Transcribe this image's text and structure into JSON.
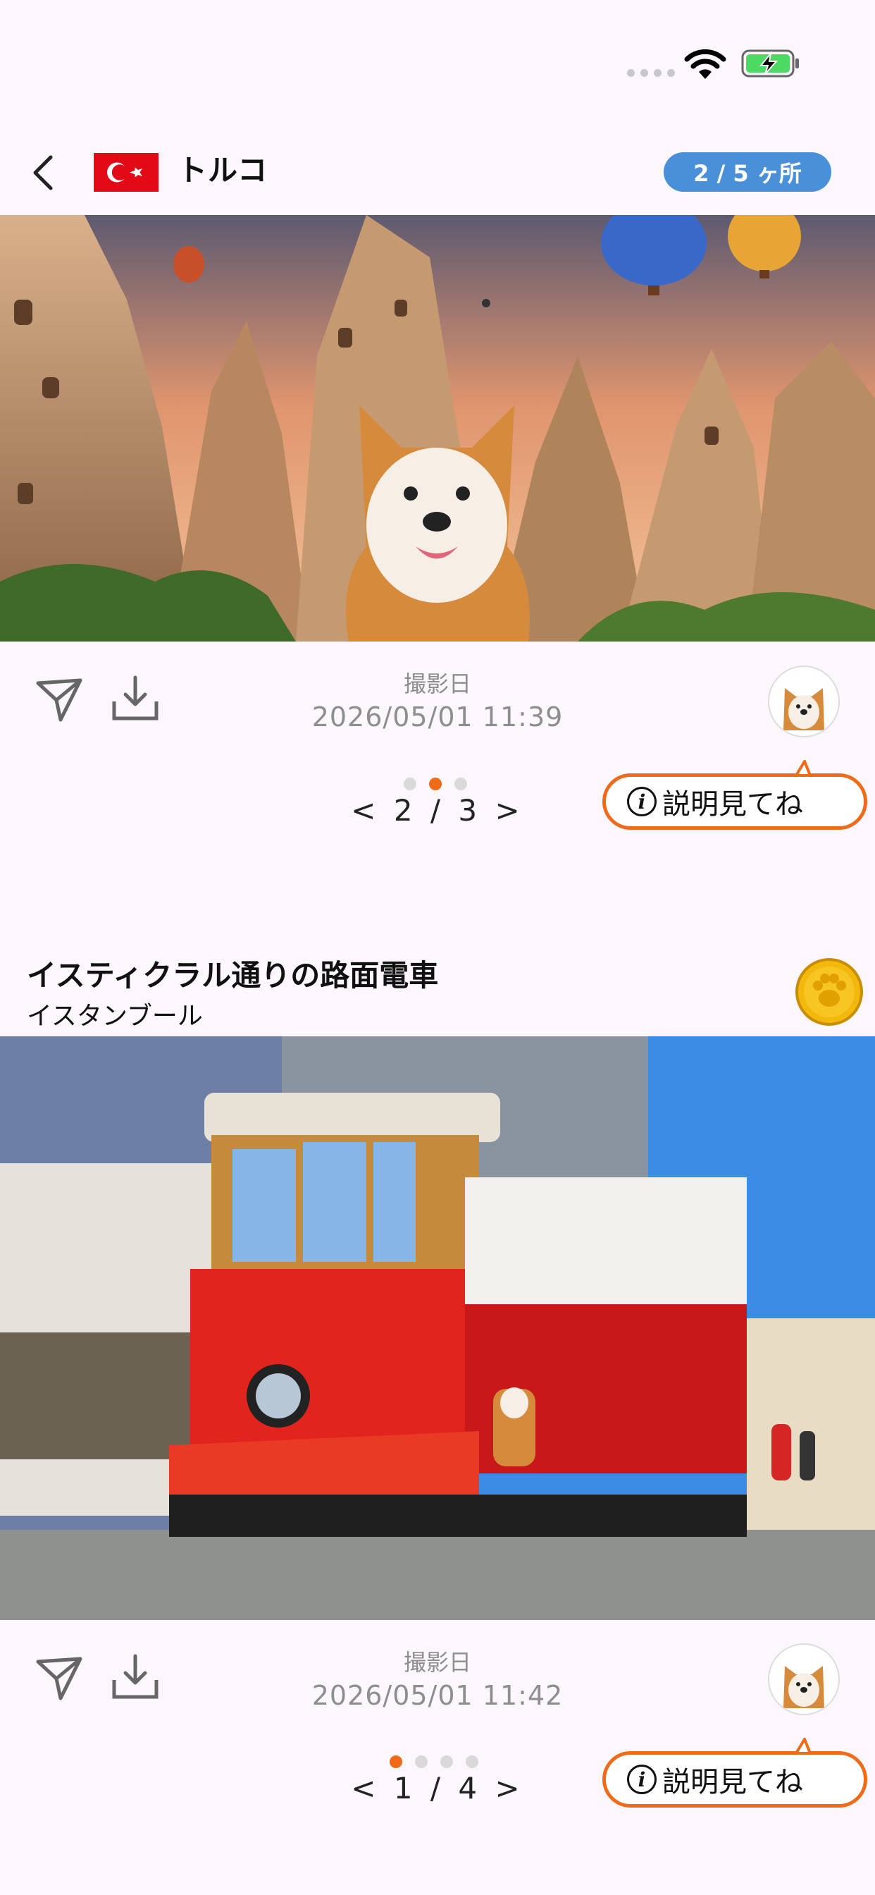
{
  "status_bar": {
    "battery": "charging"
  },
  "header": {
    "back_icon": "chevron-left-icon",
    "flag_icon": "turkey-flag-icon",
    "title": "トルコ",
    "count_badge": "2 / 5 ヶ所"
  },
  "cards": [
    {
      "photo_description_icon": "cappadocia-photo",
      "date_label": "撮影日",
      "date_value": "2026/05/01 11:39",
      "pager_dots": {
        "total": 3,
        "active": 2
      },
      "pager_text": "< 2 / 3 >",
      "explain_button": "説明見てね"
    },
    {
      "title": "イスティクラル通りの路面電車",
      "subtitle": "イスタンブール",
      "badge_icon": "paw-coin-icon",
      "photo_description_icon": "istanbul-tram-photo",
      "date_label": "撮影日",
      "date_value": "2026/05/01 11:42",
      "pager_dots": {
        "total": 4,
        "active": 1
      },
      "pager_text": "< 1 / 4 >",
      "explain_button": "説明見てね"
    }
  ],
  "colors": {
    "background": "#fcf7fd",
    "accent": "#ef6b1a",
    "badge_blue": "#4a90d9",
    "flag_red": "#e30a17"
  }
}
